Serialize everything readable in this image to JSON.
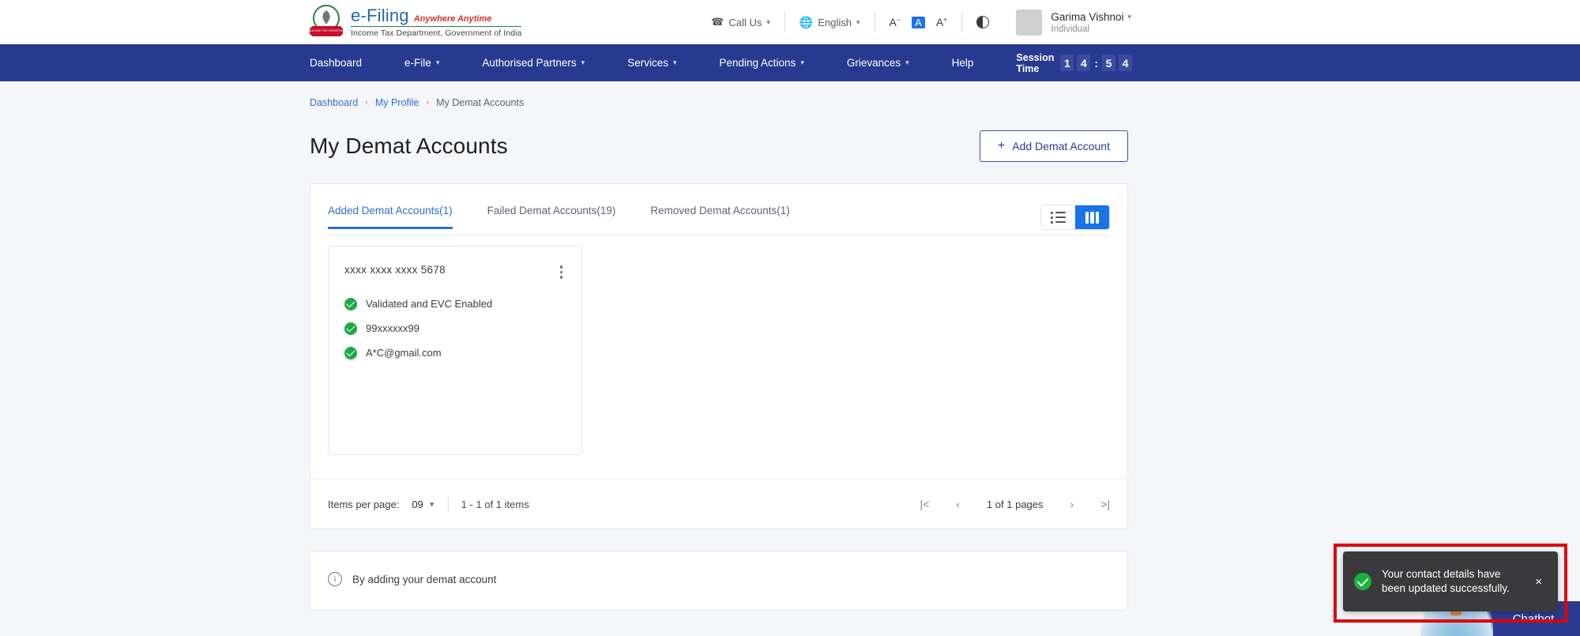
{
  "header": {
    "logo": {
      "brand": "e-Filing",
      "tagline": "Anywhere Anytime",
      "subtitle": "Income Tax Department, Government of India",
      "ribbon_text": "INCOME TAX DEPARTMENT"
    },
    "call_us": "Call Us",
    "language": "English",
    "font_decrease": "A",
    "font_normal": "A",
    "font_increase": "A",
    "user_name": "Garima Vishnoi",
    "user_role": "Individual"
  },
  "nav": {
    "items": [
      {
        "label": "Dashboard",
        "has_caret": false
      },
      {
        "label": "e-File",
        "has_caret": true
      },
      {
        "label": "Authorised Partners",
        "has_caret": true
      },
      {
        "label": "Services",
        "has_caret": true
      },
      {
        "label": "Pending Actions",
        "has_caret": true
      },
      {
        "label": "Grievances",
        "has_caret": true
      },
      {
        "label": "Help",
        "has_caret": false
      }
    ],
    "session_label": "Session Time",
    "session_digits": [
      "1",
      "4",
      "5",
      "4"
    ],
    "session_colon": ":"
  },
  "breadcrumb": {
    "item1": "Dashboard",
    "item2": "My Profile",
    "current": "My Demat Accounts",
    "separator": "›"
  },
  "page": {
    "title": "My Demat Accounts",
    "add_button": "Add Demat Account",
    "add_button_plus": "+"
  },
  "tabs": [
    {
      "label": "Added Demat Accounts(1)",
      "active": true
    },
    {
      "label": "Failed Demat Accounts(19)",
      "active": false
    },
    {
      "label": "Removed Demat Accounts(1)",
      "active": false
    }
  ],
  "view_toggle": {
    "list_icon": "list-view-icon",
    "grid_icon": "grid-view-icon",
    "active": "grid"
  },
  "accounts": [
    {
      "number": "xxxx xxxx xxxx 5678",
      "status_lines": [
        "Validated and EVC Enabled",
        "99xxxxxx99",
        "A*C@gmail.com"
      ]
    }
  ],
  "pagination": {
    "items_per_page_label": "Items per page:",
    "items_per_page_value": "09",
    "range_text": "1 - 1 of 1 items",
    "first_icon": "|<",
    "prev_icon": "‹",
    "pages_text": "1 of 1 pages",
    "next_icon": "›",
    "last_icon": ">|"
  },
  "info_panel": {
    "text": "By adding your demat account"
  },
  "toast": {
    "message": "Your contact details have been updated successfully.",
    "close_label": "×"
  },
  "chatbot": {
    "label": "Chatbot"
  },
  "colors": {
    "nav_blue": "#283a8f",
    "accent_blue": "#2e6fd4",
    "active_toggle": "#1a73e8",
    "success_green": "#1ea94a",
    "annotation_red": "#e00000",
    "toast_bg": "#3a3a3c"
  }
}
